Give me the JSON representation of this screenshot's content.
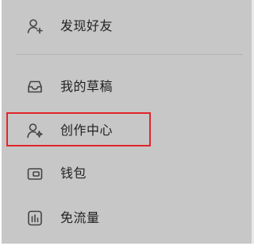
{
  "menu": {
    "items": [
      {
        "icon": "add-friend-icon",
        "label": "发现好友"
      },
      {
        "icon": "drafts-icon",
        "label": "我的草稿"
      },
      {
        "icon": "creator-center-icon",
        "label": "创作中心"
      },
      {
        "icon": "wallet-icon",
        "label": "钱包"
      },
      {
        "icon": "data-saver-icon",
        "label": "免流量"
      }
    ]
  },
  "colors": {
    "background": "#c7c7c7",
    "text": "#222222",
    "icon": "#444444",
    "highlight_border": "#e0262b"
  }
}
